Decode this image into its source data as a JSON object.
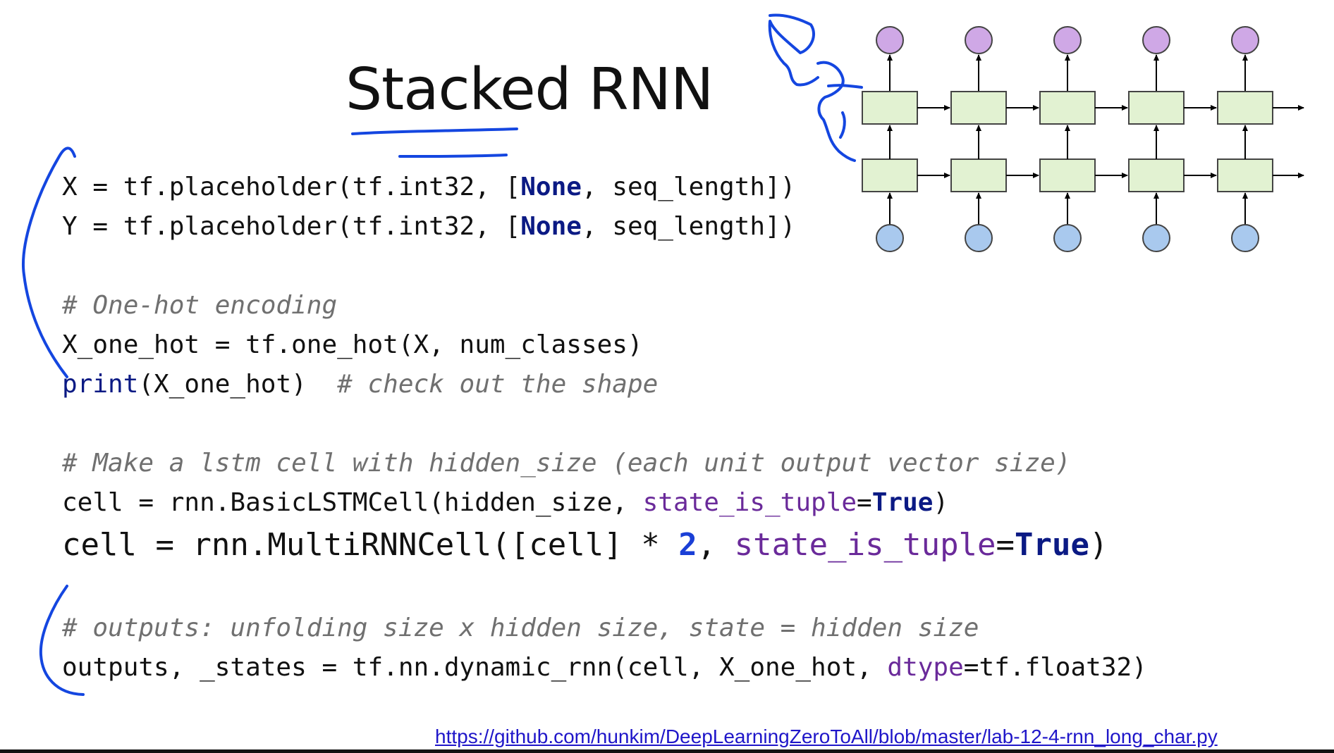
{
  "slide": {
    "title": "Stacked RNN",
    "code": {
      "line1": {
        "a": "X = tf.placeholder(tf.int32, [",
        "kw": "None",
        "b": ", seq_length])"
      },
      "line2": {
        "a": "Y = tf.placeholder(tf.int32, [",
        "kw": "None",
        "b": ", seq_length])"
      },
      "comment1": "# One-hot encoding",
      "line3": "X_one_hot = tf.one_hot(X, num_classes)",
      "line4": {
        "fn": "print",
        "a": "(X_one_hot)  ",
        "comment": "# check out the shape"
      },
      "comment2": "# Make a lstm cell with hidden_size (each unit output vector size)",
      "line5": {
        "a": "cell = rnn.BasicLSTMCell(hidden_size, ",
        "param": "state_is_tuple",
        "eq": "=",
        "kw": "True",
        "b": ")"
      },
      "line6": {
        "a": "cell = rnn.MultiRNNCell([cell] * ",
        "num": "2",
        "sep": ", ",
        "param": "state_is_tuple",
        "eq": "=",
        "kw": "True",
        "b": ")"
      },
      "comment3": "# outputs: unfolding size x hidden size, state = hidden size",
      "line7": {
        "a": "outputs, _states = tf.nn.dynamic_rnn(cell, X_one_hot, ",
        "param": "dtype",
        "b": "=tf.float32)"
      }
    },
    "link": "https://github.com/hunkim/DeepLearningZeroToAll/blob/master/lab-12-4-rnn_long_char.py"
  },
  "diagram": {
    "timesteps": 5,
    "layers": 2,
    "colors": {
      "output_node": "#cfa8e6",
      "input_node": "#a9c9ee",
      "cell": "#e2f2d2",
      "ink": "#1446e0"
    }
  }
}
